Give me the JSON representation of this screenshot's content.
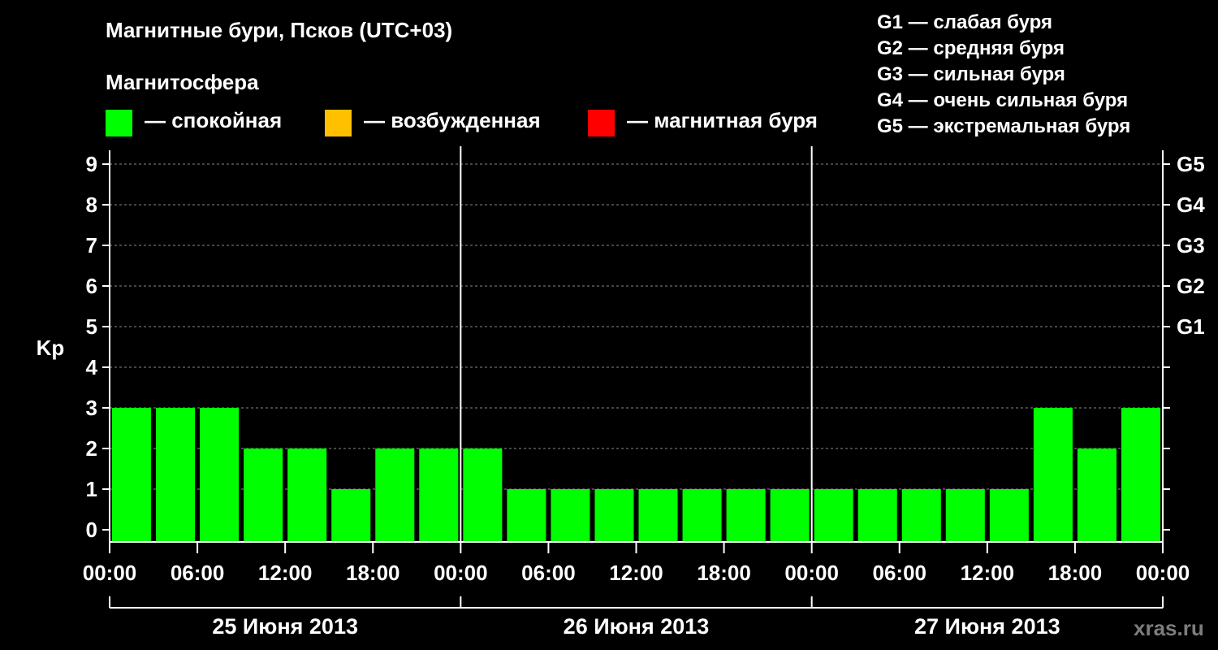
{
  "title": "Магнитные бури, Псков (UTC+03)",
  "legend": {
    "title": "Магнитосфера",
    "items": [
      {
        "label": "— спокойная",
        "color": "#00ff00"
      },
      {
        "label": "— возбужденная",
        "color": "#ffc000"
      },
      {
        "label": "— магнитная буря",
        "color": "#ff0000"
      }
    ]
  },
  "g_legend": [
    "G1 — слабая буря",
    "G2 — средняя буря",
    "G3 — сильная буря",
    "G4 — очень сильная буря",
    "G5 — экстремальная буря"
  ],
  "watermark": "xras.ru",
  "chart_data": {
    "type": "bar",
    "ylabel": "Kp",
    "ylim": [
      0,
      9
    ],
    "y_ticks": [
      "0",
      "1",
      "2",
      "3",
      "4",
      "5",
      "6",
      "7",
      "8",
      "9"
    ],
    "right_ticks": [
      {
        "kp": 5,
        "label": "G1"
      },
      {
        "kp": 6,
        "label": "G2"
      },
      {
        "kp": 7,
        "label": "G3"
      },
      {
        "kp": 8,
        "label": "G4"
      },
      {
        "kp": 9,
        "label": "G5"
      }
    ],
    "x_tick_labels": [
      "00:00",
      "06:00",
      "12:00",
      "18:00",
      "00:00",
      "06:00",
      "12:00",
      "18:00",
      "00:00",
      "06:00",
      "12:00",
      "18:00",
      "00:00"
    ],
    "days": [
      "25 Июня 2013",
      "26 Июня 2013",
      "27 Июня 2013"
    ],
    "interval_hours": 3,
    "values": [
      3,
      3,
      3,
      2,
      2,
      1,
      2,
      2,
      2,
      1,
      1,
      1,
      1,
      1,
      1,
      1,
      1,
      1,
      1,
      1,
      1,
      3,
      2,
      3
    ],
    "bar_color": "#00ff00",
    "grid": true
  }
}
